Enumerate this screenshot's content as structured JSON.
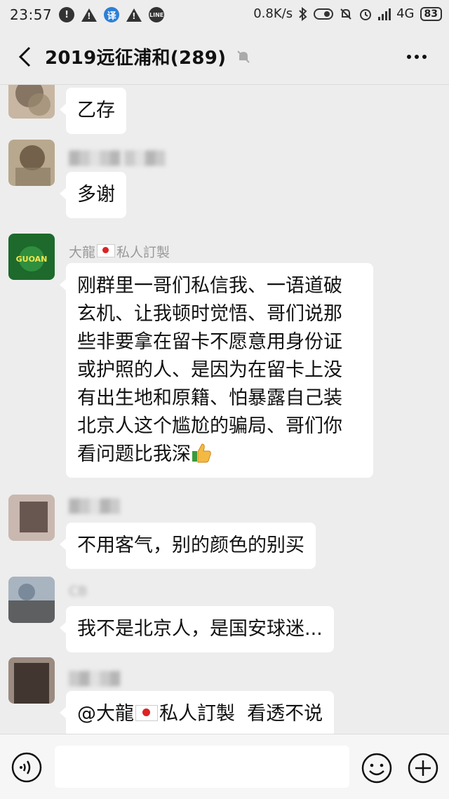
{
  "status_bar": {
    "time": "23:57",
    "notif_1": "!",
    "notif_2": "!",
    "translate_label": "译",
    "notif_3": "!",
    "line_label": "LINE",
    "net_speed": "0.8K/s",
    "network": "4G",
    "battery": "83"
  },
  "header": {
    "title": "2019远征浦和(289)"
  },
  "messages": [
    {
      "sender": "",
      "text": "乙存"
    },
    {
      "sender": "",
      "text": "多谢"
    },
    {
      "sender_prefix": "大龍",
      "sender_suffix": "私人訂製",
      "avatar_text": "GUOAN",
      "lines": [
        "刚群里一哥们私信我、一语道破",
        "玄机、让我顿时觉悟、哥们说那",
        "些非要拿在留卡不愿意用身份证",
        "或护照的人、是因为在留卡上没",
        "有出生地和原籍、怕暴露自己装",
        "北京人这个尴尬的骗局、哥们你",
        "看问题比我深"
      ]
    },
    {
      "sender": "",
      "text": "不用客气，别的颜色的别买"
    },
    {
      "sender": "CB",
      "text": "我不是北京人，是国安球迷..."
    },
    {
      "sender": "",
      "mention_prefix": "@大龍",
      "mention_suffix": "私人訂製  看透不说"
    }
  ],
  "colors": {
    "background": "#ededed",
    "bubble": "#ffffff",
    "nickname": "#999999",
    "accent": "#2d7fd6"
  },
  "icons": {
    "back": "chevron-left-icon",
    "mute": "bell-off-icon",
    "more": "more-icon",
    "voice": "voice-icon",
    "emoji": "emoji-icon",
    "plus": "plus-icon"
  }
}
